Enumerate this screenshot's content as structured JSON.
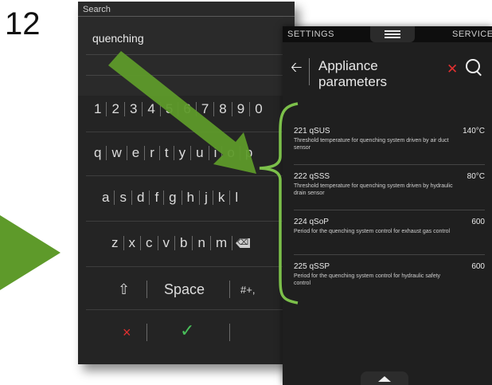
{
  "step_number": "12",
  "keyboard": {
    "title": "Search",
    "input_value": "quenching",
    "number_row": [
      "1",
      "2",
      "3",
      "4",
      "5",
      "6",
      "7",
      "8",
      "9",
      "0"
    ],
    "row_qwerty": [
      "q",
      "w",
      "e",
      "r",
      "t",
      "y",
      "u",
      "i",
      "o",
      "p"
    ],
    "row_asdf": [
      "a",
      "s",
      "d",
      "f",
      "g",
      "h",
      "j",
      "k",
      "l"
    ],
    "row_zxcv": [
      "z",
      "x",
      "c",
      "v",
      "b",
      "n",
      "m"
    ],
    "space_label": "Space",
    "symbols_label": "#+,",
    "backspace_label": "⌫",
    "shift_label": "⇧",
    "cancel_label": "×",
    "confirm_label": "✓",
    "accent_red": "#e03030",
    "accent_green": "#49c05a"
  },
  "settings": {
    "tab_left": "SETTINGS",
    "tab_right": "SERVICE",
    "title_line1": "Appliance",
    "title_line2": "parameters",
    "parameters": [
      {
        "code": "221 qSUS",
        "value": "140°C",
        "description": "Threshold temperature for quenching system driven by air duct sensor"
      },
      {
        "code": "222 qSSS",
        "value": "80°C",
        "description": "Threshold temperature for quenching system driven by hydraulic drain sensor"
      },
      {
        "code": "224 qSoP",
        "value": "600",
        "description": "Period for the quenching system control for exhaust gas control"
      },
      {
        "code": "225 qSSP",
        "value": "600",
        "description": "Period for the quenching system control for hydraulic safety control"
      }
    ]
  },
  "annotation_color": "#6fa82e"
}
